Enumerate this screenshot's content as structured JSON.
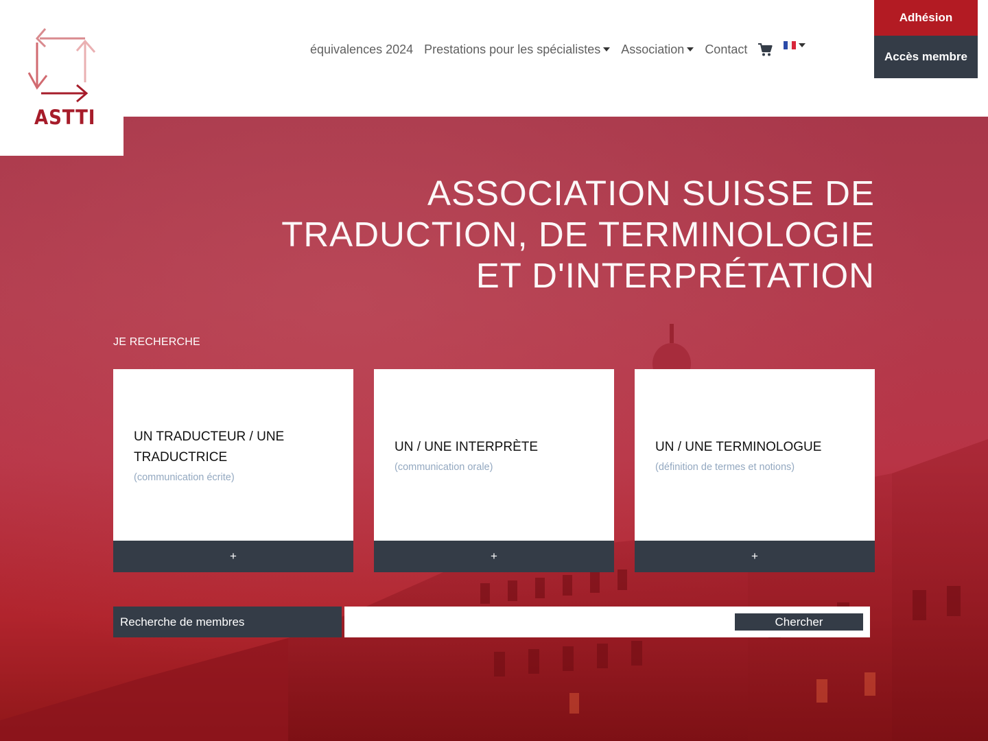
{
  "logo": {
    "text": "ASTTI",
    "icon": "astti-arrows-logo",
    "brand_color": "#a61c2a"
  },
  "nav": {
    "items": [
      {
        "label": "équivalences 2024",
        "dropdown": false
      },
      {
        "label": "Prestations pour les spécialistes",
        "dropdown": true
      },
      {
        "label": "Association",
        "dropdown": true
      },
      {
        "label": "Contact",
        "dropdown": false
      }
    ],
    "cart_icon": "shopping-cart-icon",
    "language_icon": "french-flag-icon"
  },
  "header_buttons": {
    "join": "Adhésion",
    "member_access": "Accès membre"
  },
  "hero": {
    "title": "ASSOCIATION SUISSE DE TRADUCTION, DE TERMINOLOGIE ET D'INTERPRÉTATION",
    "search_label": "JE RECHERCHE"
  },
  "cards": [
    {
      "title": "UN TRADUCTEUR / UNE TRADUCTRICE",
      "subtitle": "(communication écrite)",
      "button": "+"
    },
    {
      "title": "UN / UNE INTERPRÈTE",
      "subtitle": "(communication orale)",
      "button": "+"
    },
    {
      "title": "UN / UNE TERMINOLOGUE",
      "subtitle": "(définition de termes et notions)",
      "button": "+"
    }
  ],
  "member_search": {
    "label": "Recherche de membres",
    "input_value": "",
    "button": "Chercher"
  },
  "colors": {
    "primary_red": "#b31b23",
    "dark_slate": "#343c47",
    "subtitle": "#93a8c0"
  }
}
